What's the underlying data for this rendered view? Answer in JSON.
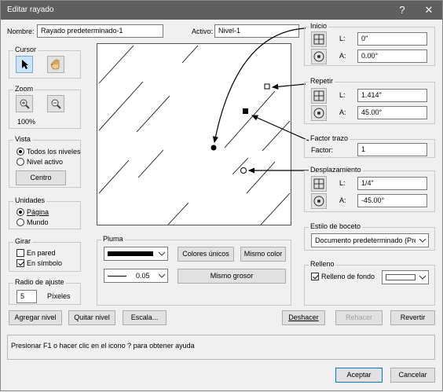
{
  "window": {
    "title": "Editar rayado",
    "help_glyph": "?",
    "close_glyph": "✕"
  },
  "name_row": {
    "label": "Nombre:",
    "value": "Rayado predeterminado-1",
    "active_label": "Activo:",
    "active_value": "Nivel-1"
  },
  "cursor": {
    "title": "Cursor"
  },
  "zoom": {
    "title": "Zoom",
    "level": "100%"
  },
  "vista": {
    "title": "Vista",
    "options": [
      "Todos los niveles",
      "Nivel activo"
    ],
    "selected": 0,
    "center_button": "Centro"
  },
  "unidades": {
    "title": "Unidades",
    "options": [
      "Página",
      "Mundo"
    ],
    "selected": 0
  },
  "girar": {
    "title": "Girar",
    "options": [
      {
        "label": "En pared",
        "checked": false
      },
      {
        "label": "En símbolo",
        "checked": true
      }
    ]
  },
  "radio_ajuste": {
    "title": "Radio de ajuste",
    "value": "5",
    "unit": "Píxeles"
  },
  "inicio": {
    "title": "Inicio",
    "l_label": "L:",
    "l_value": "0\"",
    "a_label": "A:",
    "a_value": "0.00°"
  },
  "repetir": {
    "title": "Repetir",
    "l_label": "L:",
    "l_value": "1.414\"",
    "a_label": "A:",
    "a_value": "45.00°"
  },
  "factor_trazo": {
    "title": "Factor trazo",
    "label": "Factor:",
    "value": "1"
  },
  "desplazamiento": {
    "title": "Desplazamiento",
    "l_label": "L:",
    "l_value": "1/4\"",
    "a_label": "A:",
    "a_value": "-45.00°"
  },
  "estilo_boceto": {
    "title": "Estilo de boceto",
    "value": "Documento predeterminado (Prelimin"
  },
  "relleno": {
    "title": "Relleno",
    "checkbox_label": "Relleno de fondo",
    "checked": true
  },
  "pluma": {
    "title": "Pluma",
    "weight": "0.05",
    "colores_unicos": "Colores únicos",
    "mismo_color": "Mismo color",
    "mismo_grosor": "Mismo grosor"
  },
  "actions": {
    "agregar_nivel": "Agregar nivel",
    "quitar_nivel": "Quitar nivel",
    "escala": "Escala...",
    "deshacer": "Deshacer",
    "rehacer": "Rehacer",
    "revertir": "Revertir"
  },
  "help_text": "Presionar F1 o hacer clic en el icono ? para obtener ayuda",
  "footer": {
    "accept": "Aceptar",
    "cancel": "Cancelar"
  },
  "colors": {
    "titlebar": "#5f5f5f",
    "dialog_bg": "#f0f0f0",
    "accent": "#0078d7"
  }
}
